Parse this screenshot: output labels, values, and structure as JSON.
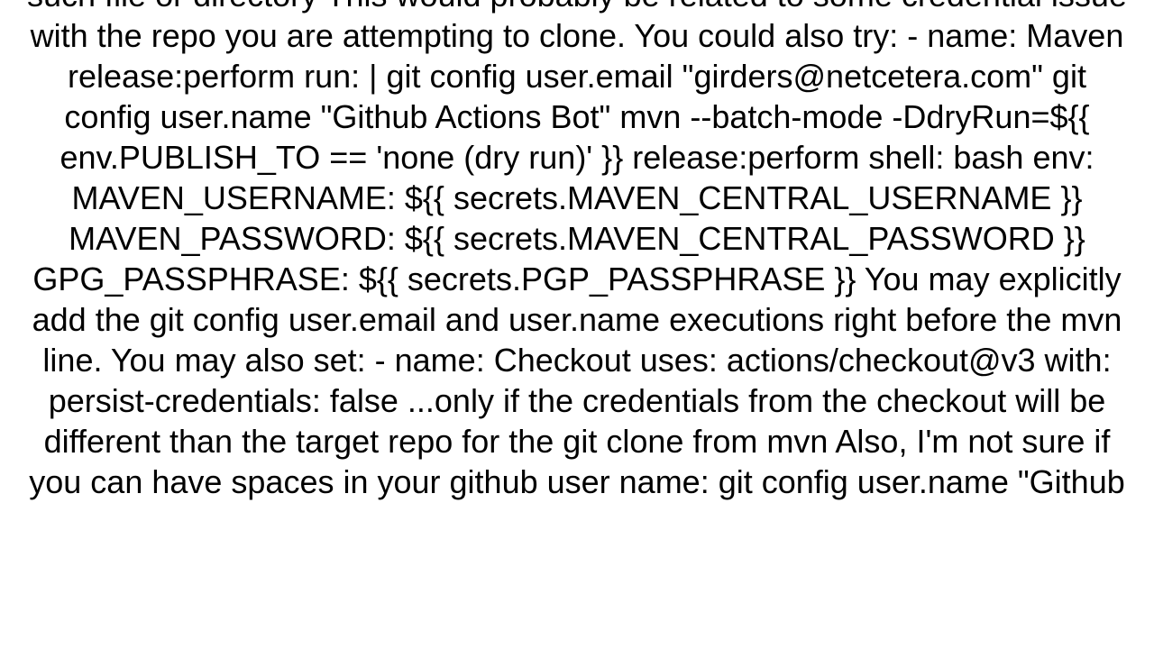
{
  "content": {
    "text": "such file or directory This would probably be related to some credential issue with the repo you are attempting to clone. You could also try:   - name: Maven release:perform     run: |       git config user.email \"girders@netcetera.com\"       git config user.name \"Github Actions Bot\"       mvn --batch-mode -DdryRun=${{ env.PUBLISH_TO == 'none (dry run)' }} release:perform     shell: bash     env:       MAVEN_USERNAME: ${{ secrets.MAVEN_CENTRAL_USERNAME }}       MAVEN_PASSWORD: ${{ secrets.MAVEN_CENTRAL_PASSWORD }}       GPG_PASSPHRASE: ${{ secrets.PGP_PASSPHRASE }}  You may explicitly add the git config user.email and user.name executions right before the mvn line. You may also set:   - name: Checkout     uses: actions/checkout@v3     with:       persist-credentials: false  ...only if the credentials from the checkout will be different than the target repo for the git clone from mvn Also, I'm not sure if you can have spaces in your github user name:   git config user.name \"Github"
  }
}
